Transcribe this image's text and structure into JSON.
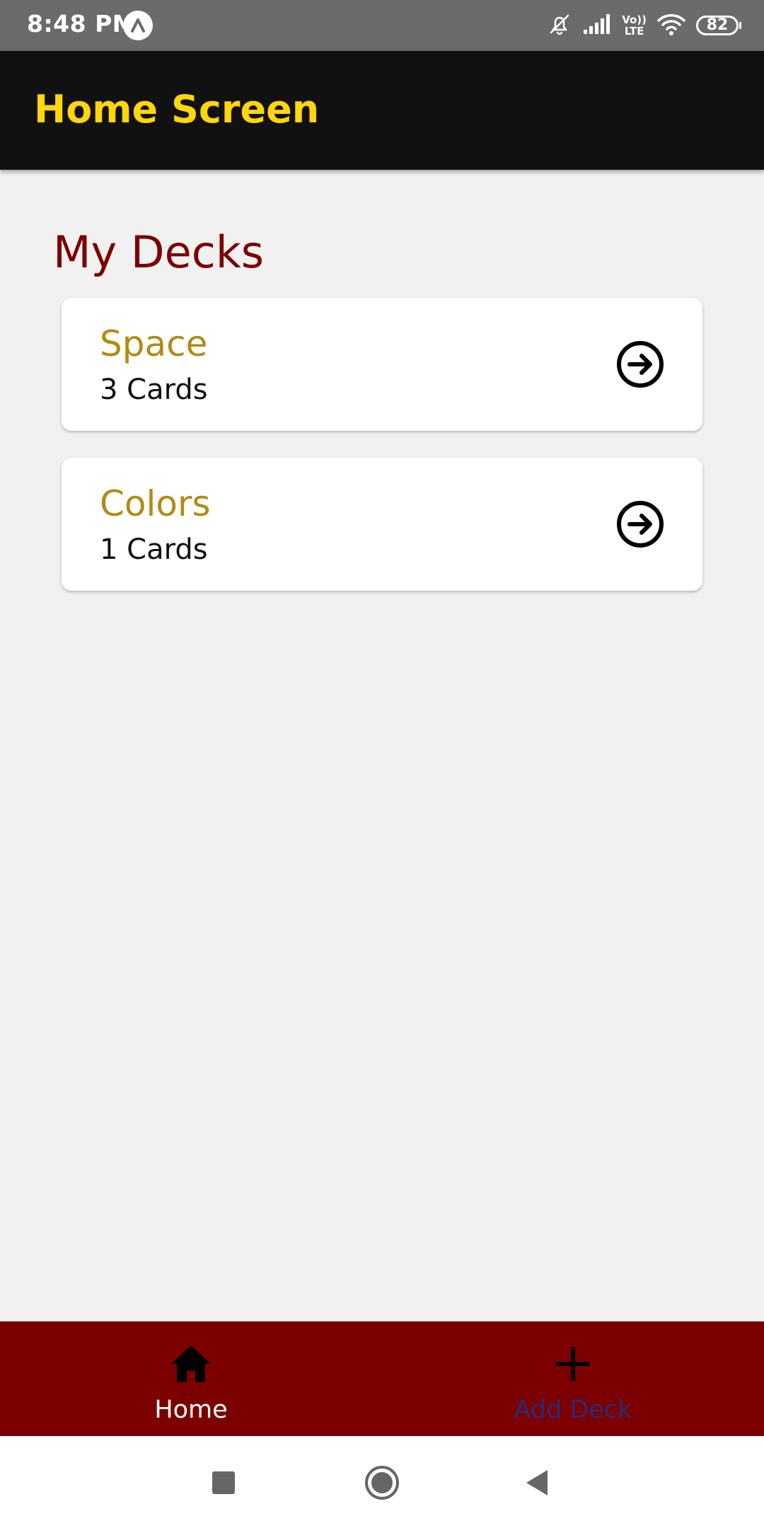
{
  "status_bar": {
    "time": "8:48 PM",
    "volte_top": "Vo))",
    "volte_bottom": "LTE",
    "battery": "82"
  },
  "app_bar": {
    "title": "Home Screen"
  },
  "main": {
    "section_title": "My Decks",
    "decks": [
      {
        "name": "Space",
        "count": "3 Cards",
        "icon": "arrow-right-circle-icon"
      },
      {
        "name": "Colors",
        "count": "1 Cards",
        "icon": "arrow-right-circle-icon"
      }
    ]
  },
  "tab_bar": {
    "tabs": [
      {
        "label": "Home",
        "icon": "home-icon",
        "active": true
      },
      {
        "label": "Add Deck",
        "icon": "plus-icon",
        "active": false
      }
    ]
  },
  "nav_bar": {
    "buttons": [
      "recents-icon",
      "home-circle-icon",
      "back-icon"
    ]
  },
  "colors": {
    "status_bar": "#6b6b6b",
    "app_bar": "#111111",
    "title_accent": "#ffd60a",
    "section_title": "#7d0000",
    "deck_name": "#b38a16",
    "tab_bar": "#7d0000",
    "tab_inactive_label": "#2b2a7a",
    "background": "#f1f1f2"
  }
}
